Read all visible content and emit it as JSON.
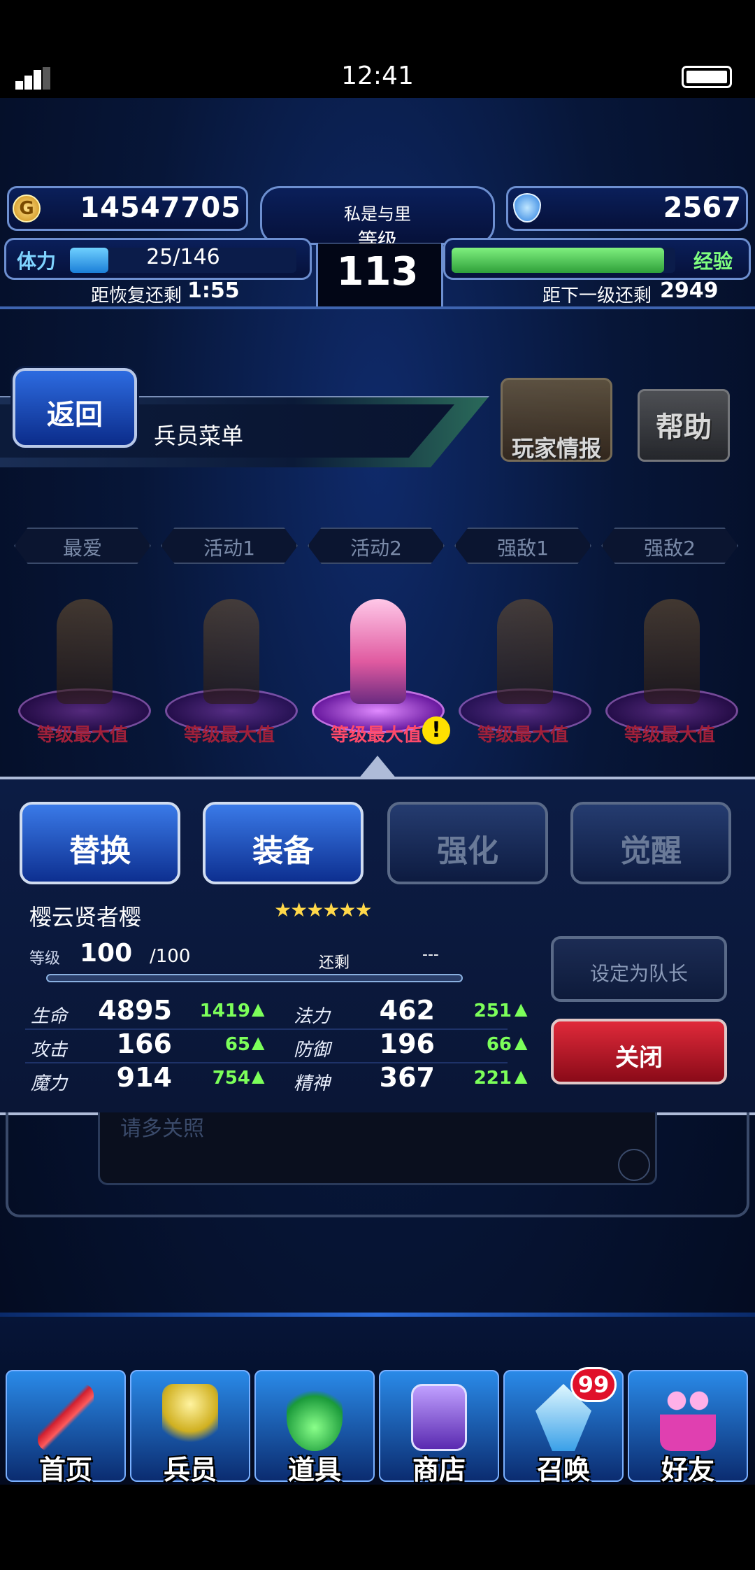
{
  "status": {
    "time": "12:41"
  },
  "header": {
    "gil": "14547705",
    "player_name": "私是与里",
    "level_label": "等级",
    "level": "113",
    "gems": "2567",
    "stamina_label": "体力",
    "stamina": "25/146",
    "stamina_fraction": 0.17,
    "recover_label": "距恢复还剩",
    "recover_time": "1:55",
    "exp_label": "经验",
    "exp_fraction": 0.95,
    "next_label": "距下一级还剩",
    "next_value": "2949"
  },
  "title_row": {
    "back": "返回",
    "title": "兵员菜单",
    "player_info": "玩家情报",
    "help": "帮助"
  },
  "party_tabs": [
    "最爱",
    "活动1",
    "活动2",
    "强敌1",
    "强敌2"
  ],
  "units": [
    {
      "status": "等级最大值",
      "active": false
    },
    {
      "status": "等级最大值",
      "active": false
    },
    {
      "status": "等级最大值",
      "active": true
    },
    {
      "status": "等级最大值",
      "active": false
    },
    {
      "status": "等级最大值",
      "active": false
    }
  ],
  "actions": [
    {
      "label": "替换",
      "enabled": true
    },
    {
      "label": "装备",
      "enabled": true
    },
    {
      "label": "强化",
      "enabled": false
    },
    {
      "label": "觉醒",
      "enabled": false
    }
  ],
  "unit_detail": {
    "name": "樱云贤者樱",
    "stars": "★★★★★★",
    "level_label": "等级",
    "level": "100",
    "level_max": "/100",
    "remain_label": "还剩",
    "remain_value": "---",
    "stats": [
      {
        "k1": "生命",
        "v1": "4895",
        "b1": "1419",
        "k2": "法力",
        "v2": "462",
        "b2": "251"
      },
      {
        "k1": "攻击",
        "v1": "166",
        "b1": "65",
        "k2": "防御",
        "v2": "196",
        "b2": "66"
      },
      {
        "k1": "魔力",
        "v1": "914",
        "b1": "754",
        "k2": "精神",
        "v2": "367",
        "b2": "221"
      }
    ],
    "set_leader": "设定为队长",
    "close": "关闭"
  },
  "card": {
    "comment": "请多关照"
  },
  "nav": [
    {
      "label": "首页",
      "icon": "sword-icon"
    },
    {
      "label": "兵员",
      "icon": "warrior-icon"
    },
    {
      "label": "道具",
      "icon": "potion-icon"
    },
    {
      "label": "商店",
      "icon": "shop-icon"
    },
    {
      "label": "召唤",
      "icon": "crystal-icon",
      "badge": "99"
    },
    {
      "label": "好友",
      "icon": "friends-icon"
    }
  ]
}
